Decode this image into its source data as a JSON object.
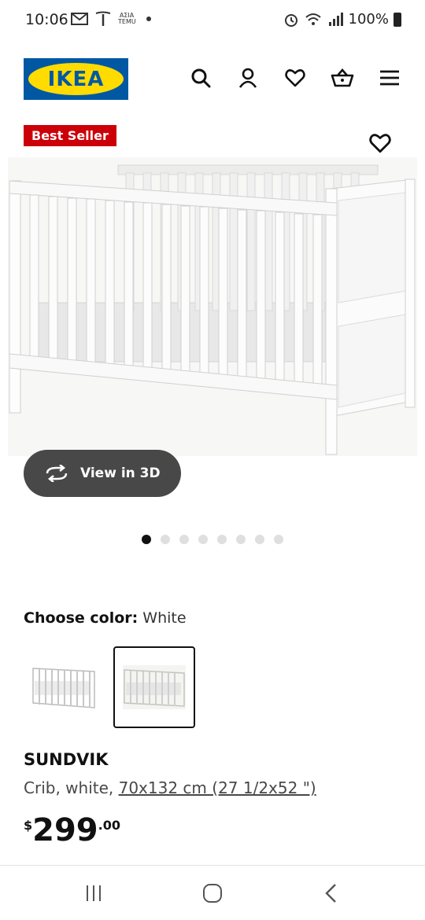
{
  "status_bar": {
    "time": "10:06",
    "temu_text": "ΑΣΙΑ TEMU",
    "battery": "100%"
  },
  "header": {
    "logo_text": "IKEA",
    "icons": [
      "search-icon",
      "user-icon",
      "heart-icon",
      "basket-icon",
      "menu-icon"
    ]
  },
  "product": {
    "badge": "Best Seller",
    "view_3d_label": "View in 3D",
    "carousel_count": 8,
    "carousel_active": 1,
    "color_label": "Choose color:",
    "color_value": "White",
    "name": "SUNDVIK",
    "desc_prefix": "Crib, white, ",
    "desc_dims": "70x132 cm (27 1/2x52 \")",
    "price_currency": "$",
    "price_main": "299",
    "price_cents": ".00"
  },
  "colors": {
    "ikea_blue": "#0058a3",
    "ikea_yellow": "#ffdb00",
    "badge_red": "#cc0008",
    "view3d_bg": "#484848"
  }
}
